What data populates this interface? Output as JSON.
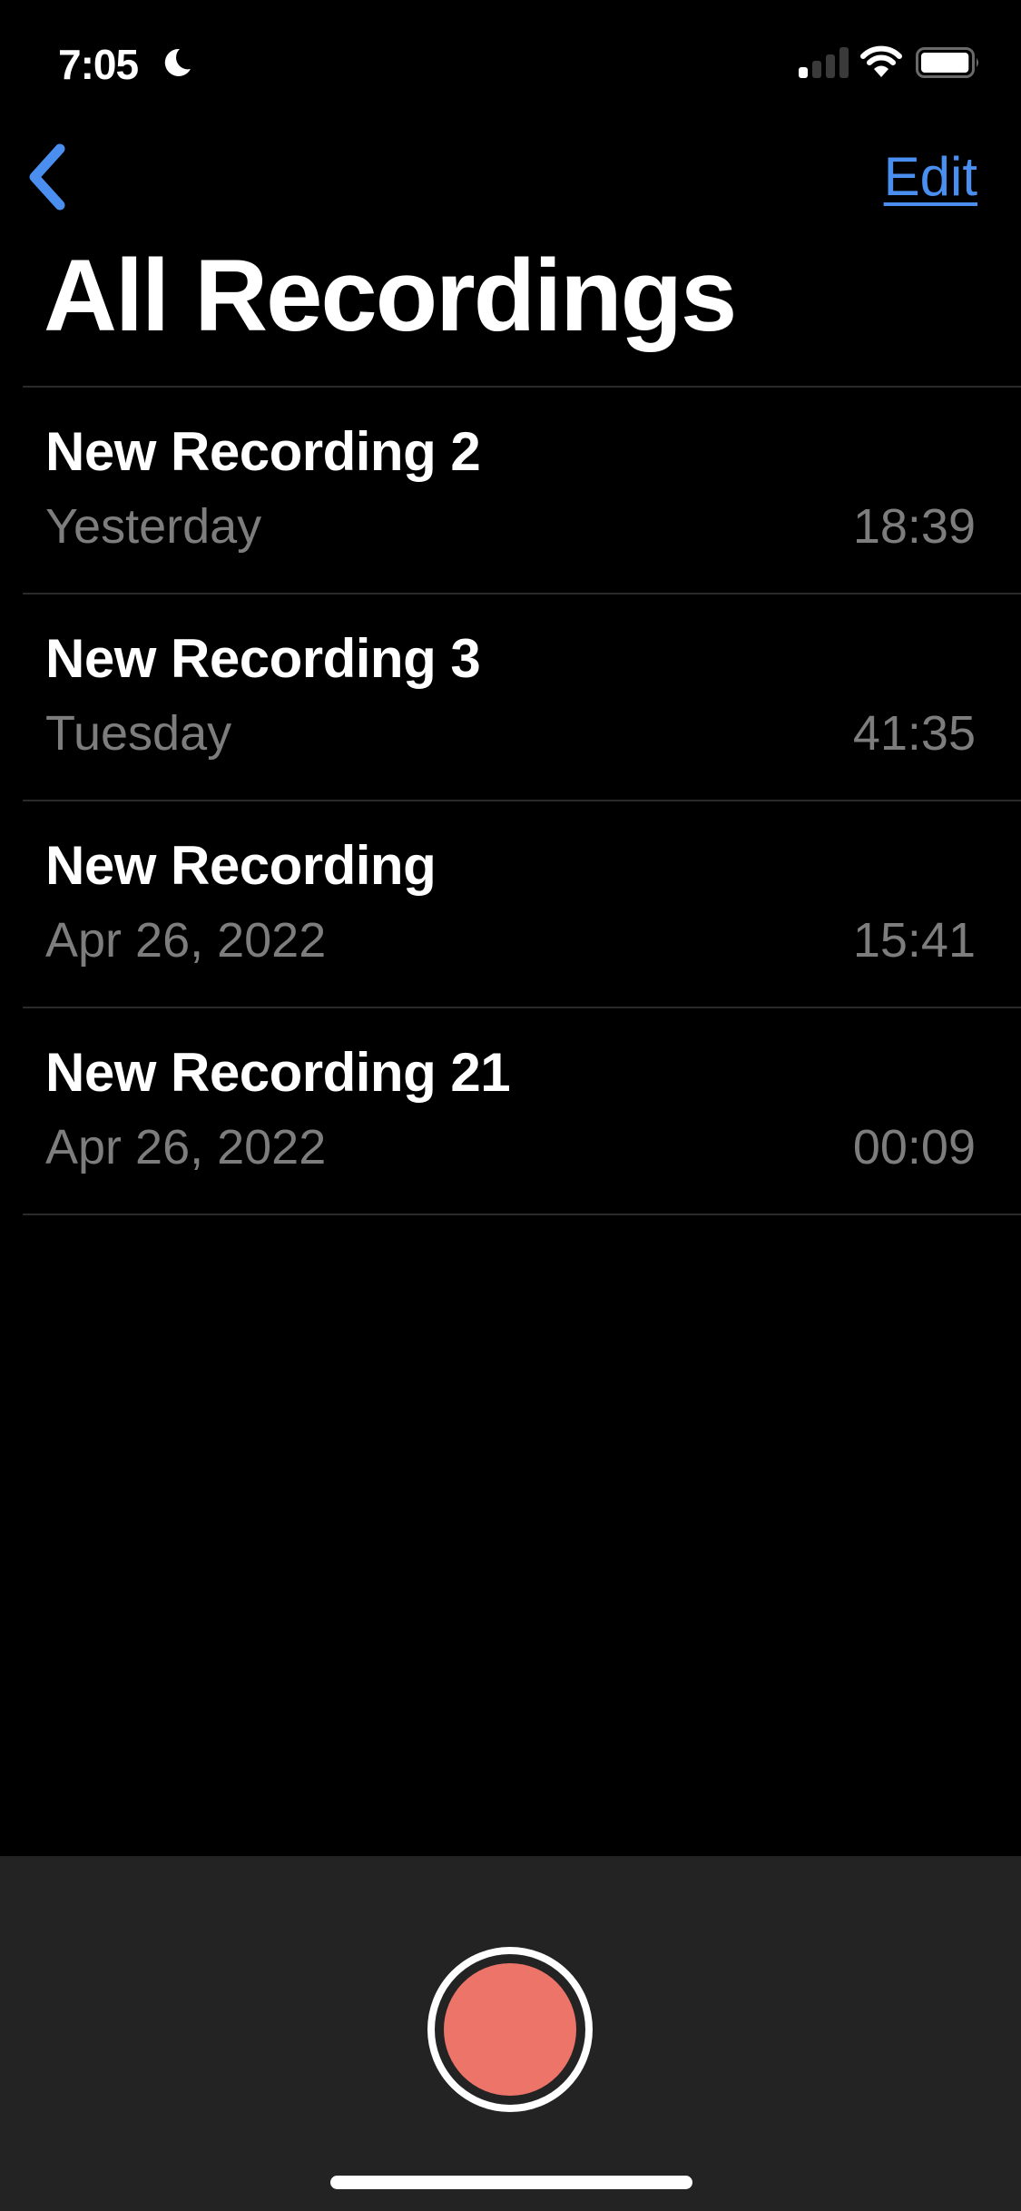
{
  "status_bar": {
    "time": "7:05",
    "focus_icon": "moon-icon",
    "signal_bars_active": 1,
    "signal_bars_total": 4,
    "wifi_icon": "wifi-icon",
    "battery_level": 0.95
  },
  "nav": {
    "back_icon": "chevron-left-icon",
    "edit_label": "Edit",
    "accent_color": "#4a8ff0"
  },
  "header": {
    "title": "All Recordings"
  },
  "recordings": [
    {
      "title": "New Recording 2",
      "date": "Yesterday",
      "duration": "18:39"
    },
    {
      "title": "New Recording 3",
      "date": "Tuesday",
      "duration": "41:35"
    },
    {
      "title": "New Recording",
      "date": "Apr 26, 2022",
      "duration": "15:41"
    },
    {
      "title": "New Recording 21",
      "date": "Apr 26, 2022",
      "duration": "00:09"
    }
  ],
  "bottom": {
    "record_icon": "record-icon",
    "record_color": "#ec7469"
  }
}
